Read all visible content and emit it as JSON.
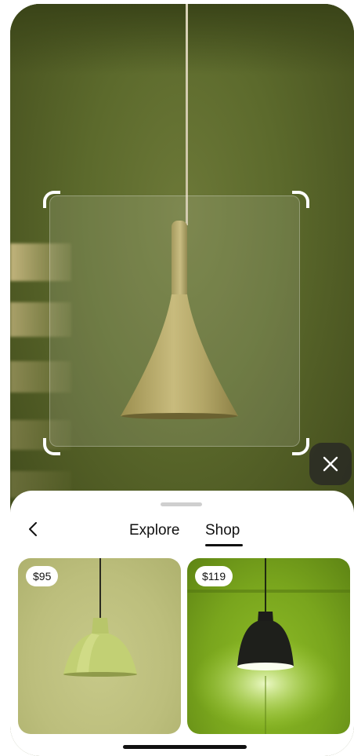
{
  "scene": {
    "description_icon": "pendant-lamp-photo"
  },
  "controls": {
    "close_icon": "close-icon"
  },
  "sheet": {
    "back_icon": "chevron-left-icon",
    "tabs": [
      {
        "label": "Explore",
        "selected": false
      },
      {
        "label": "Shop",
        "selected": true
      }
    ]
  },
  "products": [
    {
      "price": "$95",
      "image_icon": "green-dome-pendant-lamp"
    },
    {
      "price": "$119",
      "image_icon": "black-pendant-lamp-lit"
    }
  ],
  "colors": {
    "accent": "#111111",
    "sheet_bg": "#ffffff",
    "scene_bg": "#5c6a2c"
  }
}
